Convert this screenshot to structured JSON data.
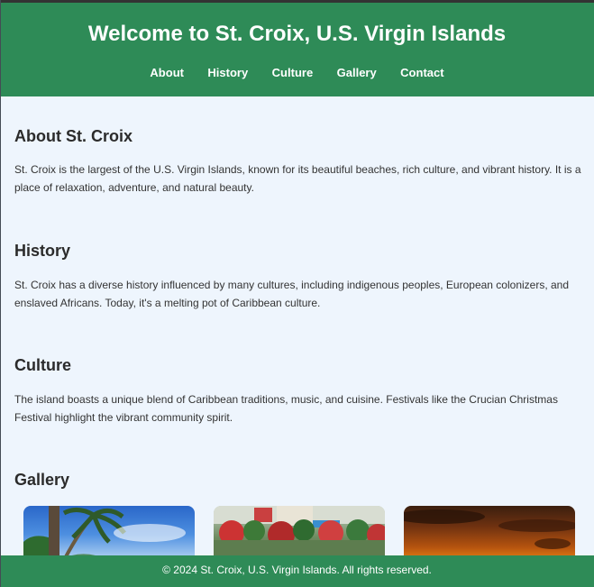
{
  "header": {
    "title": "Welcome to St. Croix, U.S. Virgin Islands",
    "nav": [
      "About",
      "History",
      "Culture",
      "Gallery",
      "Contact"
    ]
  },
  "sections": {
    "about": {
      "heading": "About St. Croix",
      "text": "St. Croix is the largest of the U.S. Virgin Islands, known for its beautiful beaches, rich culture, and vibrant history. It is a place of relaxation, adventure, and natural beauty."
    },
    "history": {
      "heading": "History",
      "text": "St. Croix has a diverse history influenced by many cultures, including indigenous peoples, European colonizers, and enslaved Africans. Today, it's a melting pot of Caribbean culture."
    },
    "culture": {
      "heading": "Culture",
      "text": "The island boasts a unique blend of Caribbean traditions, music, and cuisine. Festivals like the Crucian Christmas Festival highlight the vibrant community spirit."
    },
    "gallery": {
      "heading": "Gallery"
    }
  },
  "footer": {
    "text": "© 2024 St. Croix, U.S. Virgin Islands. All rights reserved."
  },
  "colors": {
    "header_bg": "#2e8b57",
    "page_bg": "#eef5fd",
    "text": "#333333"
  }
}
